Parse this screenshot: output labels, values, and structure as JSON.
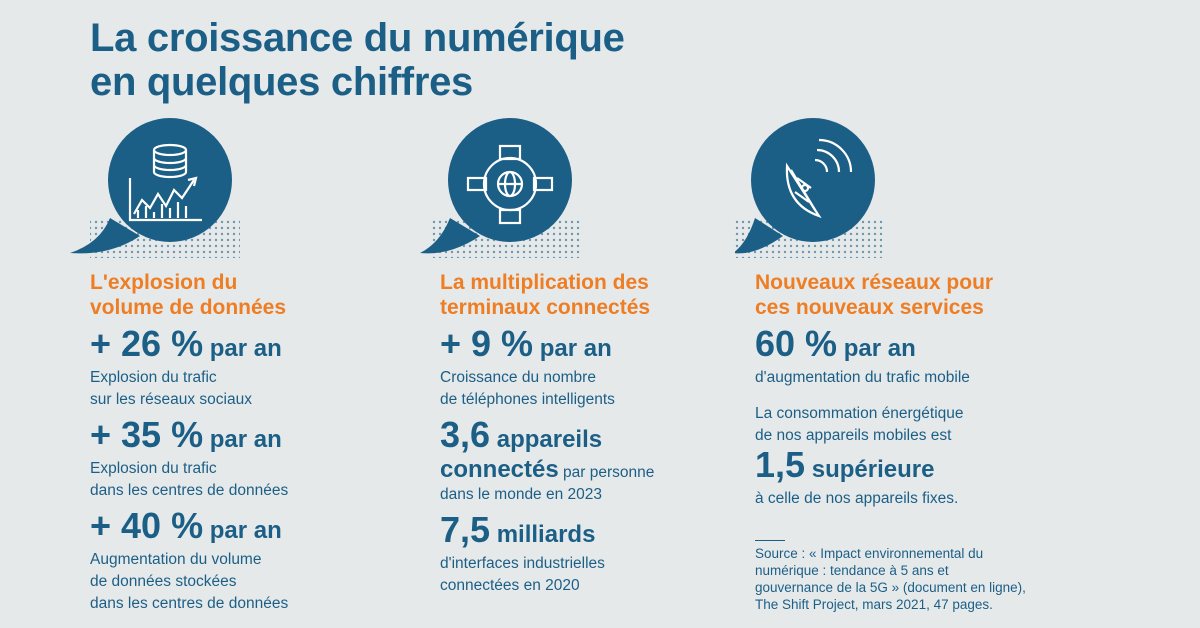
{
  "title": {
    "line1": "La croissance du numérique",
    "line2": "en quelques chiffres"
  },
  "columns": [
    {
      "icon": "database-growth-icon",
      "heading": [
        "L'explosion du",
        "volume de données"
      ],
      "stats": [
        {
          "big": "+ 26 %",
          "suffix": " par an",
          "desc": [
            "Explosion du trafic",
            "sur les réseaux sociaux"
          ]
        },
        {
          "big": "+ 35 %",
          "suffix": " par an",
          "desc": [
            "Explosion du trafic",
            "dans les centres de données"
          ]
        },
        {
          "big": "+ 40 %",
          "suffix": " par an",
          "desc": [
            "Augmentation du volume",
            "de données stockées",
            "dans les centres de données"
          ]
        }
      ]
    },
    {
      "icon": "connected-devices-globe-icon",
      "heading": [
        "La multiplication des",
        "terminaux connectés"
      ],
      "stats": [
        {
          "big": "+ 9 %",
          "suffix": " par an",
          "desc": [
            "Croissance du nombre",
            "de téléphones intelligents"
          ]
        },
        {
          "big": "3,6",
          "suffix": " appareils",
          "big2": "connectés",
          "inline": " par personne",
          "desc": [
            "dans le monde en 2023"
          ]
        },
        {
          "big": "7,5",
          "suffix": " milliards",
          "desc": [
            "d'interfaces industrielles",
            "connectées en 2020"
          ]
        }
      ]
    },
    {
      "icon": "satellite-dish-icon",
      "heading": [
        "Nouveaux réseaux pour",
        "ces nouveaux services"
      ],
      "stats": [
        {
          "big": "60 %",
          "suffix": " par an",
          "desc": [
            "d'augmentation du trafic mobile"
          ]
        },
        {
          "pre": [
            "La consommation énergétique",
            "de nos appareils mobiles est"
          ],
          "big": "1,5",
          "suffix": " supérieure",
          "desc": [
            "à celle de nos appareils fixes."
          ]
        }
      ],
      "source": [
        "Source : « Impact environnemental du",
        "numérique : tendance à 5 ans et",
        "gouvernance de la 5G » (document en ligne),",
        "The Shift Project, mars 2021, 47 pages."
      ]
    }
  ],
  "colors": {
    "primary": "#1c5f86",
    "accent": "#ee7d23",
    "background": "#e6e9ea"
  }
}
